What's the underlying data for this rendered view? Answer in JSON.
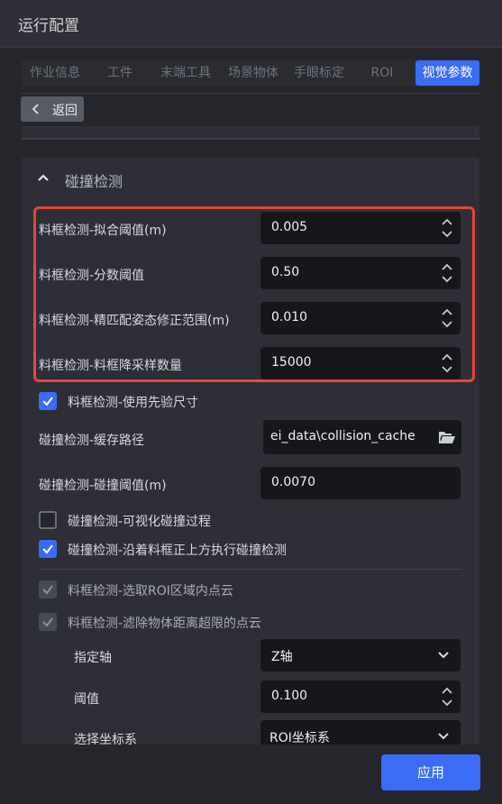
{
  "window": {
    "title": "运行配置"
  },
  "tabs": [
    {
      "label": "作业信息"
    },
    {
      "label": "工件"
    },
    {
      "label": "末端工具"
    },
    {
      "label": "场景物体"
    },
    {
      "label": "手眼标定"
    },
    {
      "label": "ROI"
    },
    {
      "label": "视觉参数",
      "active": true
    }
  ],
  "back": {
    "label": "返回"
  },
  "section": {
    "title": "碰撞检测",
    "fields": [
      {
        "label": "料框检测-拟合阈值(m)",
        "value": "0.005"
      },
      {
        "label": "料框检测-分数阈值",
        "value": "0.50"
      },
      {
        "label": "料框检测-精匹配姿态修正范围(m)",
        "value": "0.010"
      },
      {
        "label": "料框检测-料框降采样数量",
        "value": "15000"
      }
    ],
    "use_prior_size": {
      "label": "料框检测-使用先验尺寸",
      "checked": true
    },
    "cache_path": {
      "label": "碰撞检测-缓存路径",
      "value": "ei_data\\collision_cache"
    },
    "collision_threshold": {
      "label": "碰撞检测-碰撞阈值(m)",
      "value": "0.0070"
    },
    "visualize": {
      "label": "碰撞检测-可视化碰撞过程",
      "checked": false
    },
    "along_top": {
      "label": "碰撞检测-沿着料框正上方执行碰撞检测",
      "checked": true
    },
    "select_roi": {
      "label": "料框检测-选取ROI区域内点云",
      "checked": true,
      "disabled": true
    },
    "filter_far": {
      "label": "料框检测-滤除物体距离超限的点云",
      "checked": true,
      "disabled": true
    },
    "axis": {
      "label": "指定轴",
      "value": "Z轴"
    },
    "threshold": {
      "label": "阈值",
      "value": "0.100"
    },
    "coord": {
      "label": "选择坐标系",
      "value": "ROI坐标系"
    }
  },
  "footer": {
    "apply_label": "应用"
  },
  "colors": {
    "accent": "#3b6cf6",
    "highlight": "#e6453b",
    "field_bg": "#16171b"
  }
}
